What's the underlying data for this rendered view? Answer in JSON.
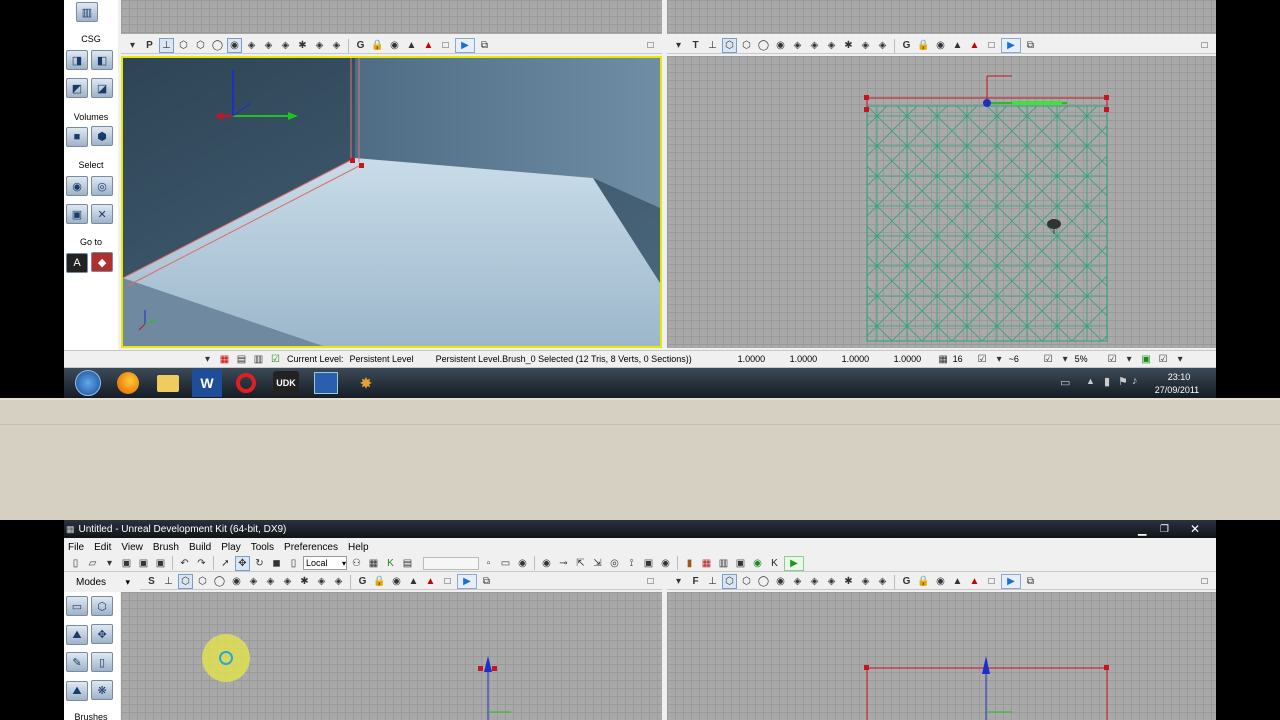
{
  "top_editor": {
    "csg_label": "CSG",
    "volumes_label": "Volumes",
    "select_label": "Select",
    "goto_label": "Go to",
    "persp_toolbar_letter": "P",
    "top_toolbar_letter": "T",
    "g_letter": "G",
    "status": {
      "current_level_label": "Current Level:",
      "current_level_value": "Persistent Level",
      "selection_text": "Persistent Level.Brush_0 Selected (12 Tris, 8 Verts, 0 Sections))",
      "scale_x": "1.0000",
      "scale_y": "1.0000",
      "scale_z": "1.0000",
      "scale_all": "1.0000",
      "grid_size": "16",
      "rotation_snap": "~6",
      "scale_snap": "5%"
    }
  },
  "taskbar": {
    "time": "23:10",
    "date": "27/09/2011",
    "apps": [
      "start-orb",
      "firefox",
      "explorer",
      "word",
      "recorder",
      "udk",
      "paint",
      "unreal"
    ]
  },
  "bottom_editor": {
    "window_title": "Untitled - Unreal Development Kit (64-bit, DX9)",
    "menu": [
      "File",
      "Edit",
      "View",
      "Brush",
      "Build",
      "Play",
      "Tools",
      "Preferences",
      "Help"
    ],
    "coord_system": "Local",
    "modes_label": "Modes",
    "side_toolbar_letter": "S",
    "front_toolbar_letter": "F",
    "g_letter": "G",
    "brushes_label": "Brushes"
  },
  "colors": {
    "grid": "#a9a9a9",
    "wireframe": "#2fa37a",
    "selection_outline": "#e8e800",
    "brush_red": "#c8141e",
    "panel_beige": "#d6d0c2",
    "taskbar": "#1c2632"
  }
}
